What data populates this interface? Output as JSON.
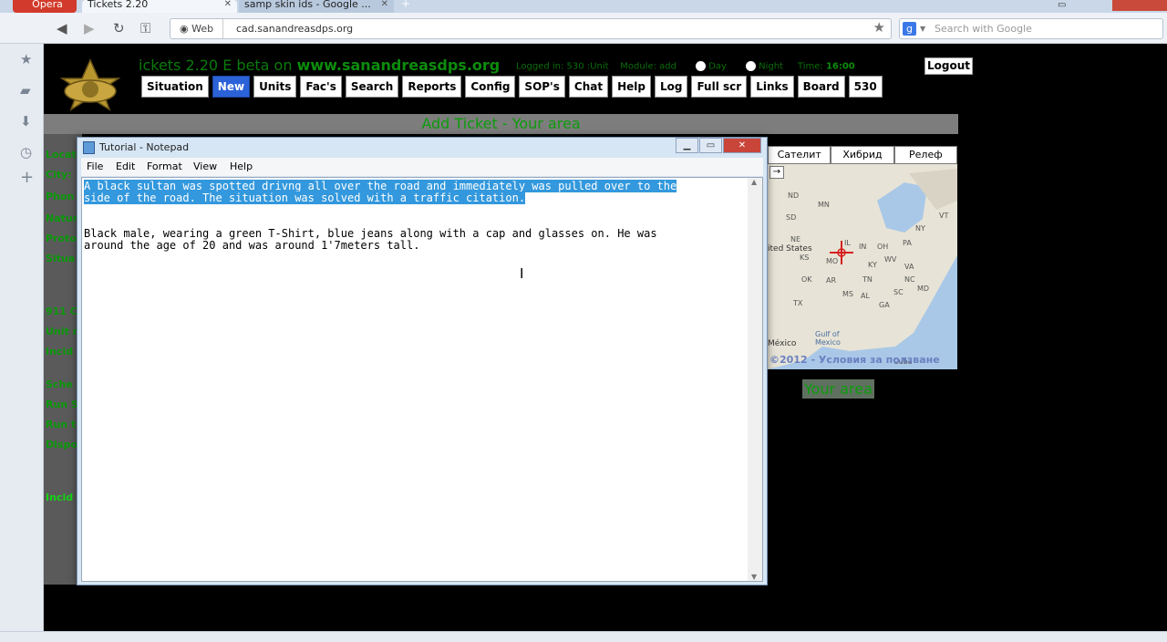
{
  "browser": {
    "opera_button": "Opera",
    "tabs": [
      {
        "label": "Tickets 2.20"
      },
      {
        "label": "samp skin ids - Google ..."
      }
    ],
    "address": {
      "web_label": "Web",
      "url": "cad.sanandreasdps.org"
    },
    "search_placeholder": "Search with Google"
  },
  "site": {
    "header_title": "ickets 2.20 E beta on",
    "header_site": "www.sanandreasdps.org",
    "logged_in": "Logged in: 530 :Unit",
    "module": "Module: add",
    "day_label": "Day",
    "night_label": "Night",
    "time_label": "Time:",
    "time_value": "16:00",
    "logout": "Logout",
    "nav": [
      "Situation",
      "New",
      "Units",
      "Fac's",
      "Search",
      "Reports",
      "Config",
      "SOP's",
      "Chat",
      "Help",
      "Log",
      "Full scr",
      "Links",
      "Board",
      "530"
    ],
    "active_nav": "New",
    "page_title": "Add Ticket - Your area",
    "form_labels": [
      "Locat",
      "City:",
      "Phon",
      "Natur",
      "Proto",
      "Situa",
      "911 C",
      "Unit n",
      "Incid",
      "Sche",
      "Run S",
      "Run t",
      "Dispo",
      "Incid"
    ],
    "map_types": [
      "Сателит",
      "Хибрид",
      "Релеф"
    ],
    "map_copyright": "©2012 - Условия за ползване",
    "map_labels": [
      "ND",
      "MN",
      "SD",
      "NE",
      "KS",
      "OK",
      "TX",
      "MO",
      "AR",
      "MS",
      "AL",
      "TN",
      "KY",
      "IN",
      "IL",
      "OH",
      "WV",
      "VA",
      "NC",
      "SC",
      "GA",
      "PA",
      "NY",
      "VT",
      "MD",
      "ited States",
      "Gulf of Mexico",
      "México",
      "Cuba"
    ],
    "your_area": "Your area"
  },
  "notepad": {
    "title": "Tutorial - Notepad",
    "menu": [
      "File",
      "Edit",
      "Format",
      "View",
      "Help"
    ],
    "lines": [
      "A black sultan was spotted drivng all over the road and immediately was pulled over to the",
      "side of the road. The situation was solved with a traffic citation.",
      "",
      "",
      "Black male, wearing a green T-Shirt, blue jeans along with a cap and glasses on. He was",
      "around the age of 20 and was around 1'7meters tall."
    ]
  }
}
